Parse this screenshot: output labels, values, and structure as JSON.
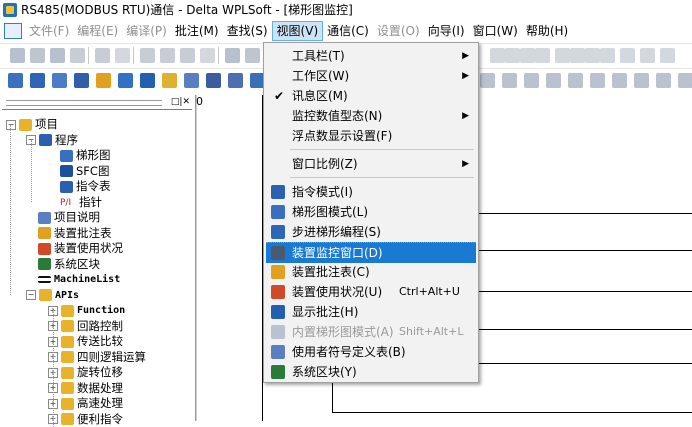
{
  "window": {
    "title": "RS485(MODBUS RTU)通信 - Delta WPLSoft - [梯形图监控]"
  },
  "menubar": [
    {
      "label": "文件(F)",
      "disabled": true
    },
    {
      "label": "编程(E)",
      "disabled": true
    },
    {
      "label": "编译(P)",
      "disabled": true
    },
    {
      "label": "批注(M)",
      "disabled": false
    },
    {
      "label": "查找(S)",
      "disabled": false
    },
    {
      "label": "视图(V)",
      "disabled": false,
      "active": true
    },
    {
      "label": "通信(C)",
      "disabled": false
    },
    {
      "label": "设置(O)",
      "disabled": true
    },
    {
      "label": "向导(I)",
      "disabled": false
    },
    {
      "label": "窗口(W)",
      "disabled": false
    },
    {
      "label": "帮助(H)",
      "disabled": false
    }
  ],
  "view_menu": [
    {
      "label": "工具栏(T)",
      "submenu": true
    },
    {
      "label": "工作区(W)",
      "submenu": true
    },
    {
      "label": "讯息区(M)",
      "checked": true
    },
    {
      "label": "监控数值型态(N)",
      "submenu": true
    },
    {
      "label": "浮点数显示设置(F)"
    },
    {
      "separator": true
    },
    {
      "label": "窗口比例(Z)",
      "submenu": true
    },
    {
      "separator": true
    },
    {
      "label": "指令模式(I)",
      "icon": "instruction-mode-icon"
    },
    {
      "label": "梯形图模式(L)",
      "icon": "ladder-mode-icon"
    },
    {
      "label": "步进梯形编程(S)",
      "icon": "step-ladder-icon"
    },
    {
      "label": "装置监控窗口(D)",
      "icon": "device-monitor-icon",
      "highlighted": true
    },
    {
      "label": "装置批注表(C)",
      "icon": "device-comment-icon"
    },
    {
      "label": "装置使用状况(U)",
      "icon": "device-usage-icon",
      "shortcut": "Ctrl+Alt+U"
    },
    {
      "label": "显示批注(H)",
      "icon": "show-comment-icon"
    },
    {
      "label": "内置梯形图模式(A)",
      "icon": "builtin-ladder-icon",
      "shortcut": "Shift+Alt+L",
      "disabled": true
    },
    {
      "label": "使用者符号定义表(B)",
      "icon": "symbol-table-icon"
    },
    {
      "label": "系统区块(Y)",
      "icon": "system-block-icon"
    }
  ],
  "project_tree": [
    {
      "label": "项目",
      "level": 0,
      "expand": "−",
      "icon": "project-folder-icon"
    },
    {
      "label": "程序",
      "level": 1,
      "expand": "−",
      "icon": "program-icon"
    },
    {
      "label": "梯形图",
      "level": 2,
      "icon": "ladder-icon"
    },
    {
      "label": "SFC图",
      "level": 2,
      "icon": "sfc-icon"
    },
    {
      "label": "指令表",
      "level": 2,
      "icon": "instruction-list-icon"
    },
    {
      "label": "指针",
      "level": 2,
      "icon": "pointer-icon"
    },
    {
      "label": "项目说明",
      "level": 1,
      "icon": "project-desc-icon"
    },
    {
      "label": "装置批注表",
      "level": 1,
      "icon": "device-comment-icon"
    },
    {
      "label": "装置使用状况",
      "level": 1,
      "icon": "device-usage-icon"
    },
    {
      "label": "系统区块",
      "level": 1,
      "icon": "system-block-icon"
    },
    {
      "label": "MachineList",
      "level": 1,
      "icon": "machine-list-icon",
      "mono": true
    },
    {
      "label": "APIs",
      "level": 1,
      "expand": "−",
      "icon": "apis-folder-icon",
      "mono": true
    },
    {
      "label": "Function",
      "level": 2,
      "expand": "+",
      "icon": "folder-icon",
      "mono": true
    },
    {
      "label": "回路控制",
      "level": 2,
      "expand": "+",
      "icon": "folder-icon"
    },
    {
      "label": "传送比较",
      "level": 2,
      "expand": "+",
      "icon": "folder-icon"
    },
    {
      "label": "四则逻辑运算",
      "level": 2,
      "expand": "+",
      "icon": "folder-icon"
    },
    {
      "label": "旋转位移",
      "level": 2,
      "expand": "+",
      "icon": "folder-icon"
    },
    {
      "label": "数据处理",
      "level": 2,
      "expand": "+",
      "icon": "folder-icon"
    },
    {
      "label": "高速处理",
      "level": 2,
      "expand": "+",
      "icon": "folder-icon"
    },
    {
      "label": "便利指令",
      "level": 2,
      "expand": "+",
      "icon": "folder-icon"
    }
  ],
  "ladder": {
    "line_number": "0"
  },
  "colors": {
    "menu_highlight": "#1a7ad2",
    "menu_bg": "#f2f2f2",
    "folder": "#e8b32a",
    "icon_blue": "#2b5fb0"
  }
}
